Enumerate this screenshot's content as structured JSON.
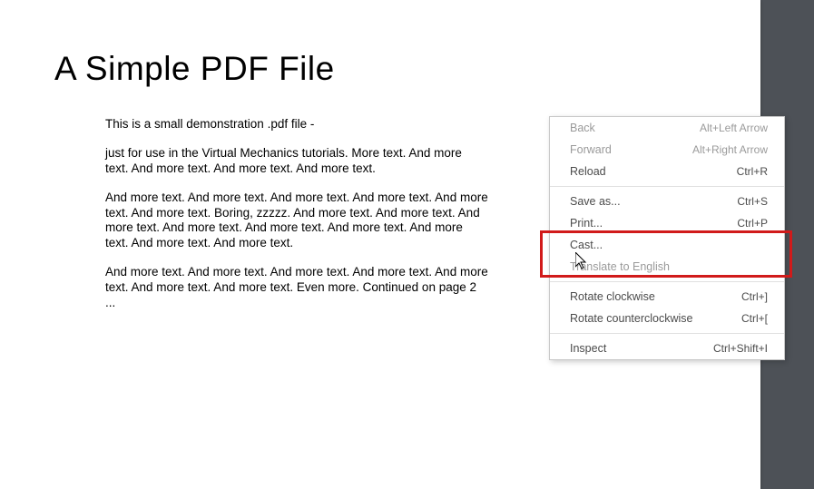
{
  "document": {
    "title": "A Simple PDF File",
    "p1": "This is a small demonstration .pdf file -",
    "p2": "just for use in the Virtual Mechanics tutorials. More text. And more text. And more text. And more text. And more text.",
    "p3": "And more text. And more text. And more text. And more text. And more text. And more text. Boring, zzzzz. And more text. And more text. And more text. And more text. And more text. And more text. And more text. And more text. And more text.",
    "p4": "And more text. And more text. And more text. And more text. And more text. And more text. And more text. Even more. Continued on page 2 ..."
  },
  "menu": {
    "back": {
      "label": "Back",
      "shortcut": "Alt+Left Arrow"
    },
    "forward": {
      "label": "Forward",
      "shortcut": "Alt+Right Arrow"
    },
    "reload": {
      "label": "Reload",
      "shortcut": "Ctrl+R"
    },
    "save_as": {
      "label": "Save as...",
      "shortcut": "Ctrl+S"
    },
    "print": {
      "label": "Print...",
      "shortcut": "Ctrl+P"
    },
    "cast": {
      "label": "Cast...",
      "shortcut": ""
    },
    "translate": {
      "label": "Translate to English",
      "shortcut": ""
    },
    "rotate_cw": {
      "label": "Rotate clockwise",
      "shortcut": "Ctrl+]"
    },
    "rotate_ccw": {
      "label": "Rotate counterclockwise",
      "shortcut": "Ctrl+["
    },
    "inspect": {
      "label": "Inspect",
      "shortcut": "Ctrl+Shift+I"
    }
  }
}
